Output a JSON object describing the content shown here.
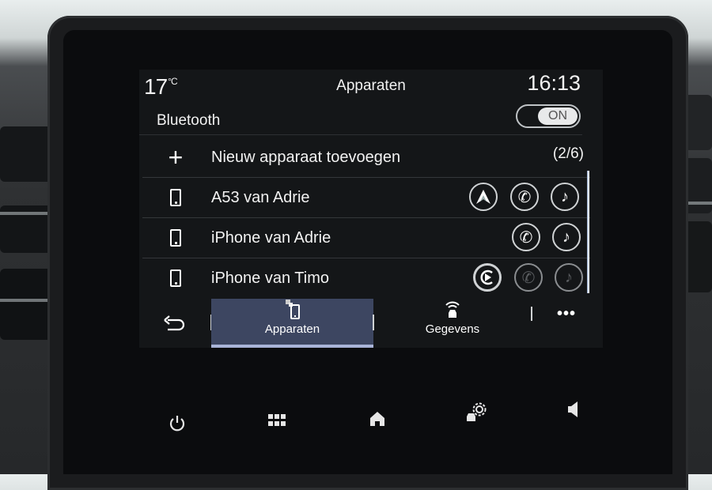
{
  "status": {
    "temperature": "17",
    "temperature_unit": "°C",
    "title": "Apparaten",
    "time": "16:13"
  },
  "bluetooth": {
    "label": "Bluetooth",
    "toggle_state": "ON"
  },
  "device_list": {
    "add_item": {
      "label": "Nieuw apparaat toevoegen",
      "icon": "plus-icon",
      "count": "(2/6)"
    },
    "devices": [
      {
        "name": "A53 van Adrie",
        "icon": "phone-icon",
        "services": [
          {
            "icon": "android-auto-icon",
            "active": true
          },
          {
            "icon": "phone-call-icon",
            "active": true
          },
          {
            "icon": "music-note-icon",
            "active": true
          }
        ]
      },
      {
        "name": "iPhone van Adrie",
        "icon": "phone-icon",
        "services": [
          {
            "icon": "phone-call-icon",
            "active": true
          },
          {
            "icon": "music-note-icon",
            "active": true
          }
        ]
      },
      {
        "name": "iPhone van Timo",
        "icon": "phone-icon",
        "services": [
          {
            "icon": "carplay-icon",
            "active": true
          },
          {
            "icon": "phone-call-icon",
            "active": false
          },
          {
            "icon": "music-note-icon",
            "active": false
          }
        ]
      }
    ]
  },
  "tabbar": {
    "back_icon": "back-arrow-icon",
    "tabs": [
      {
        "label": "Apparaten",
        "icon": "devices-icon",
        "active": true
      },
      {
        "label": "Gegevens",
        "icon": "connected-car-icon",
        "active": false
      }
    ],
    "more_label": "•••"
  },
  "system_bar": {
    "buttons": [
      "power-icon",
      "apps-grid-icon",
      "home-icon",
      "car-settings-icon",
      "volume-icon"
    ]
  },
  "colors": {
    "screen_bg": "#141618",
    "active_tab_bg": "#3d4661",
    "active_tab_underline": "#a9b4d8",
    "text": "#f2f2f2",
    "dim_icon": "#5a5d60"
  }
}
